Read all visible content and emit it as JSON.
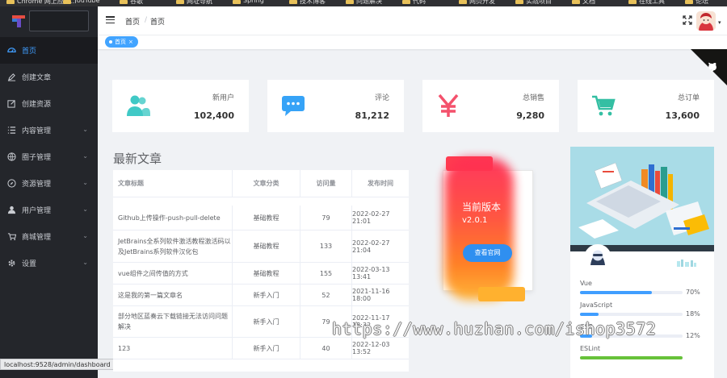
{
  "browser": {
    "bookmarks": [
      "Chrome 网上应用...",
      "YouTube",
      "谷歌",
      "网址导航",
      "Spring",
      "技术博客",
      "问题解决",
      "代码",
      "网页开发",
      "实战项目",
      "文档",
      "在线工具",
      "论坛"
    ]
  },
  "sidebar": {
    "items": [
      {
        "label": "首页",
        "icon": "dashboard-icon",
        "active": true,
        "expandable": false
      },
      {
        "label": "创建文章",
        "icon": "edit-icon",
        "active": false,
        "expandable": false
      },
      {
        "label": "创建资源",
        "icon": "edit-square-icon",
        "active": false,
        "expandable": false
      },
      {
        "label": "内容管理",
        "icon": "list-icon",
        "active": false,
        "expandable": true
      },
      {
        "label": "圈子管理",
        "icon": "globe-icon",
        "active": false,
        "expandable": true
      },
      {
        "label": "资源管理",
        "icon": "compass-icon",
        "active": false,
        "expandable": true
      },
      {
        "label": "用户管理",
        "icon": "user-icon",
        "active": false,
        "expandable": true
      },
      {
        "label": "商城管理",
        "icon": "cart-icon",
        "active": false,
        "expandable": true
      },
      {
        "label": "设置",
        "icon": "gear-icon",
        "active": false,
        "expandable": true
      }
    ],
    "arrow": "⌄"
  },
  "status_url": "localhost:9528/admin/dashboard",
  "header": {
    "breadcrumb": [
      "首页",
      "首页"
    ],
    "separator": "/",
    "caret": "▾"
  },
  "tags": [
    {
      "label": "首页",
      "close": "×"
    }
  ],
  "stats": [
    {
      "label": "新用户",
      "value": "102,400",
      "icon": "users-icon",
      "color": "#40c9c6"
    },
    {
      "label": "评论",
      "value": "81,212",
      "icon": "message-icon",
      "color": "#36a3f7"
    },
    {
      "label": "总销售",
      "value": "9,280",
      "icon": "money-icon",
      "color": "#f4516c"
    },
    {
      "label": "总订单",
      "value": "13,600",
      "icon": "shopping-cart-icon",
      "color": "#34bfa3"
    }
  ],
  "articles": {
    "title": "最新文章",
    "columns": [
      "文章标题",
      "文章分类",
      "访问量",
      "发布时间"
    ],
    "rows": [
      {
        "title": "Github上传操作-push-pull-delete",
        "category": "基础教程",
        "views": "79",
        "date": "2022-02-27 21:01"
      },
      {
        "title": "JetBrains全系列软件激活教程激活码以及JetBrains系列软件汉化包",
        "category": "基础教程",
        "views": "133",
        "date": "2022-02-27 21:04"
      },
      {
        "title": "vue组件之间传值的方式",
        "category": "基础教程",
        "views": "155",
        "date": "2022-03-13 13:41"
      },
      {
        "title": "这是我的第一篇文章名",
        "category": "新手入门",
        "views": "52",
        "date": "2021-11-16 18:00"
      },
      {
        "title": "部分地区蓝奏云下载链接无法访问问题解决",
        "category": "新手入门",
        "views": "79",
        "date": "2022-11-17 18:32"
      },
      {
        "title": "123",
        "category": "新手入门",
        "views": "40",
        "date": "2022-12-03 13:52"
      }
    ]
  },
  "version": {
    "title": "当前版本",
    "number": "v2.0.1",
    "button": "查看官网"
  },
  "skills": [
    {
      "name": "Vue",
      "percent": 70,
      "pct_label": "70%",
      "color": "#409eff"
    },
    {
      "name": "JavaScript",
      "percent": 18,
      "pct_label": "18%",
      "color": "#409eff"
    },
    {
      "name": "CSS",
      "percent": 12,
      "pct_label": "12%",
      "color": "#409eff"
    },
    {
      "name": "ESLint",
      "percent": 100,
      "pct_label": "",
      "color": "#67c23a"
    }
  ],
  "watermark": "https://www.huzhan.com/ishop3572"
}
